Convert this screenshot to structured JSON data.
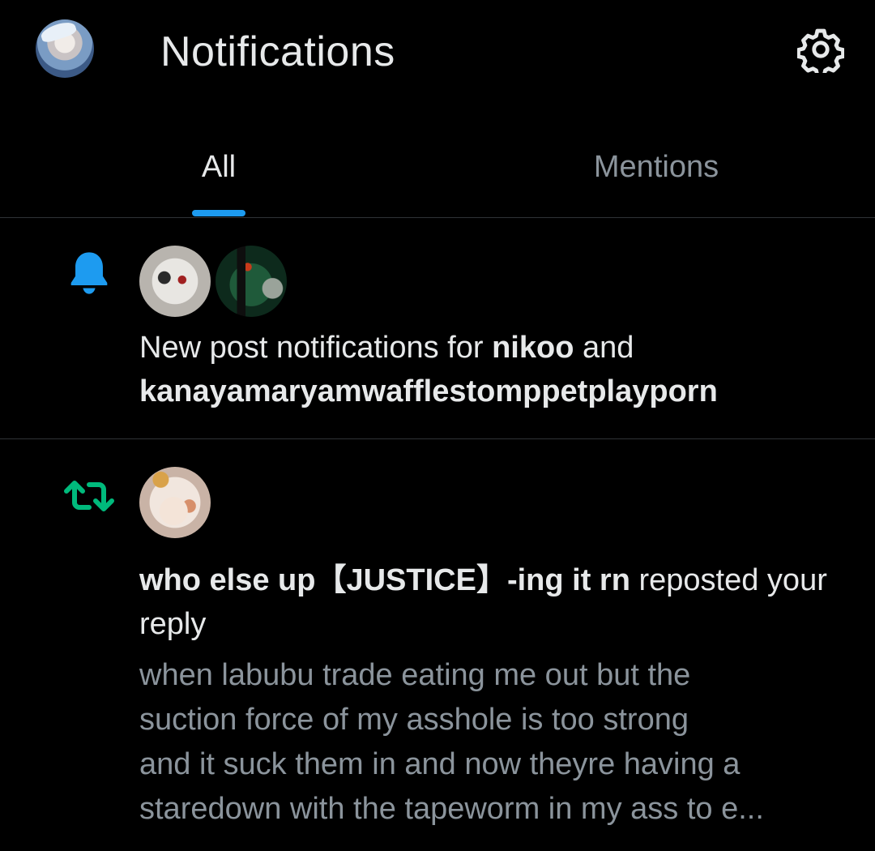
{
  "header": {
    "title": "Notifications",
    "avatar_icon": "user-avatar",
    "settings_icon": "gear-icon"
  },
  "tabs": [
    {
      "label": "All",
      "active": true
    },
    {
      "label": "Mentions",
      "active": false
    }
  ],
  "notifications": [
    {
      "type": "new-post",
      "icon": "bell-icon",
      "icon_color": "#1d9bf0",
      "text_prefix": "New post notifications for ",
      "user1": "nikoo",
      "text_middle": " and",
      "user2": "kanayamaryamwafflestomppetplayporn"
    },
    {
      "type": "repost",
      "icon": "repost-icon",
      "icon_color": "#00ba7c",
      "user": "who else up【JUSTICE】-ing it rn",
      "action": " reposted your reply",
      "snippet": "when labubu trade eating me out but the\nsuction force of my asshole is too strong\nand it suck them in and now theyre having a\nstaredown with the tapeworm in my ass to e..."
    }
  ],
  "colors": {
    "background": "#000000",
    "text_primary": "#e7e9ea",
    "text_secondary": "#8b949c",
    "accent": "#1d9bf0",
    "repost": "#00ba7c",
    "divider": "#2f3336"
  }
}
